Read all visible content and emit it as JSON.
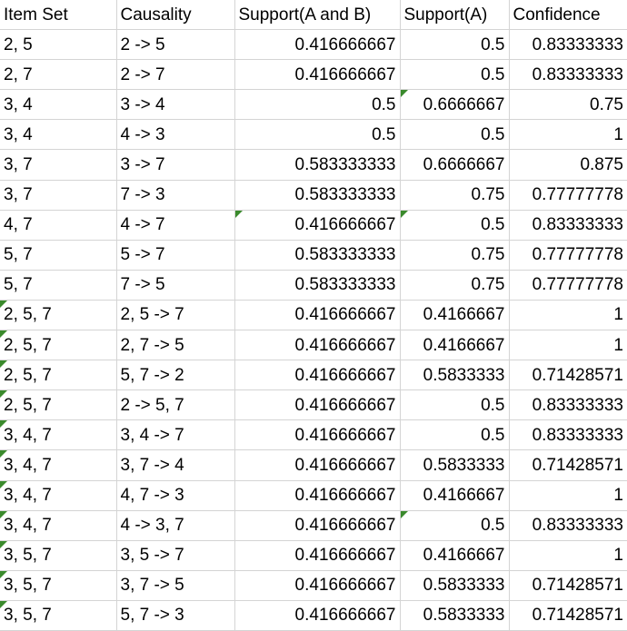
{
  "sheet": {
    "headers": [
      "Item Set",
      "Causality",
      "Support(A and B)",
      "Support(A)",
      "Confidence"
    ],
    "rows": [
      [
        "2, 5",
        "2 -> 5",
        "0.416666667",
        "0.5",
        "0.83333333"
      ],
      [
        "2, 7",
        "2 -> 7",
        "0.416666667",
        "0.5",
        "0.83333333"
      ],
      [
        "3, 4",
        "3 -> 4",
        "0.5",
        "0.6666667",
        "0.75"
      ],
      [
        "3, 4",
        "4 -> 3",
        "0.5",
        "0.5",
        "1"
      ],
      [
        "3, 7",
        "3 -> 7",
        "0.583333333",
        "0.6666667",
        "0.875"
      ],
      [
        "3, 7",
        "7 -> 3",
        "0.583333333",
        "0.75",
        "0.77777778"
      ],
      [
        "4, 7",
        "4 -> 7",
        "0.416666667",
        "0.5",
        "0.83333333"
      ],
      [
        "5, 7",
        "5 -> 7",
        "0.583333333",
        "0.75",
        "0.77777778"
      ],
      [
        "5, 7",
        "7 -> 5",
        "0.583333333",
        "0.75",
        "0.77777778"
      ],
      [
        "2, 5, 7",
        "2, 5 -> 7",
        "0.416666667",
        "0.4166667",
        "1"
      ],
      [
        "2, 5, 7",
        "2, 7 -> 5",
        "0.416666667",
        "0.4166667",
        "1"
      ],
      [
        "2, 5, 7",
        "5, 7 -> 2",
        "0.416666667",
        "0.5833333",
        "0.71428571"
      ],
      [
        "2, 5, 7",
        "2 -> 5, 7",
        "0.416666667",
        "0.5",
        "0.83333333"
      ],
      [
        "3, 4, 7",
        "3, 4 -> 7",
        "0.416666667",
        "0.5",
        "0.83333333"
      ],
      [
        "3, 4, 7",
        "3, 7 -> 4",
        "0.416666667",
        "0.5833333",
        "0.71428571"
      ],
      [
        "3, 4, 7",
        "4, 7 -> 3",
        "0.416666667",
        "0.4166667",
        "1"
      ],
      [
        "3, 4, 7",
        "4 -> 3, 7",
        "0.416666667",
        "0.5",
        "0.83333333"
      ],
      [
        "3, 5, 7",
        "3, 5 -> 7",
        "0.416666667",
        "0.4166667",
        "1"
      ],
      [
        "3, 5, 7",
        "3, 7 -> 5",
        "0.416666667",
        "0.5833333",
        "0.71428571"
      ],
      [
        "3, 5, 7",
        "5, 7 -> 3",
        "0.416666667",
        "0.5833333",
        "0.71428571"
      ]
    ],
    "indicator_color": "#3a8a2c",
    "grid_color": "#d4d4d4"
  }
}
